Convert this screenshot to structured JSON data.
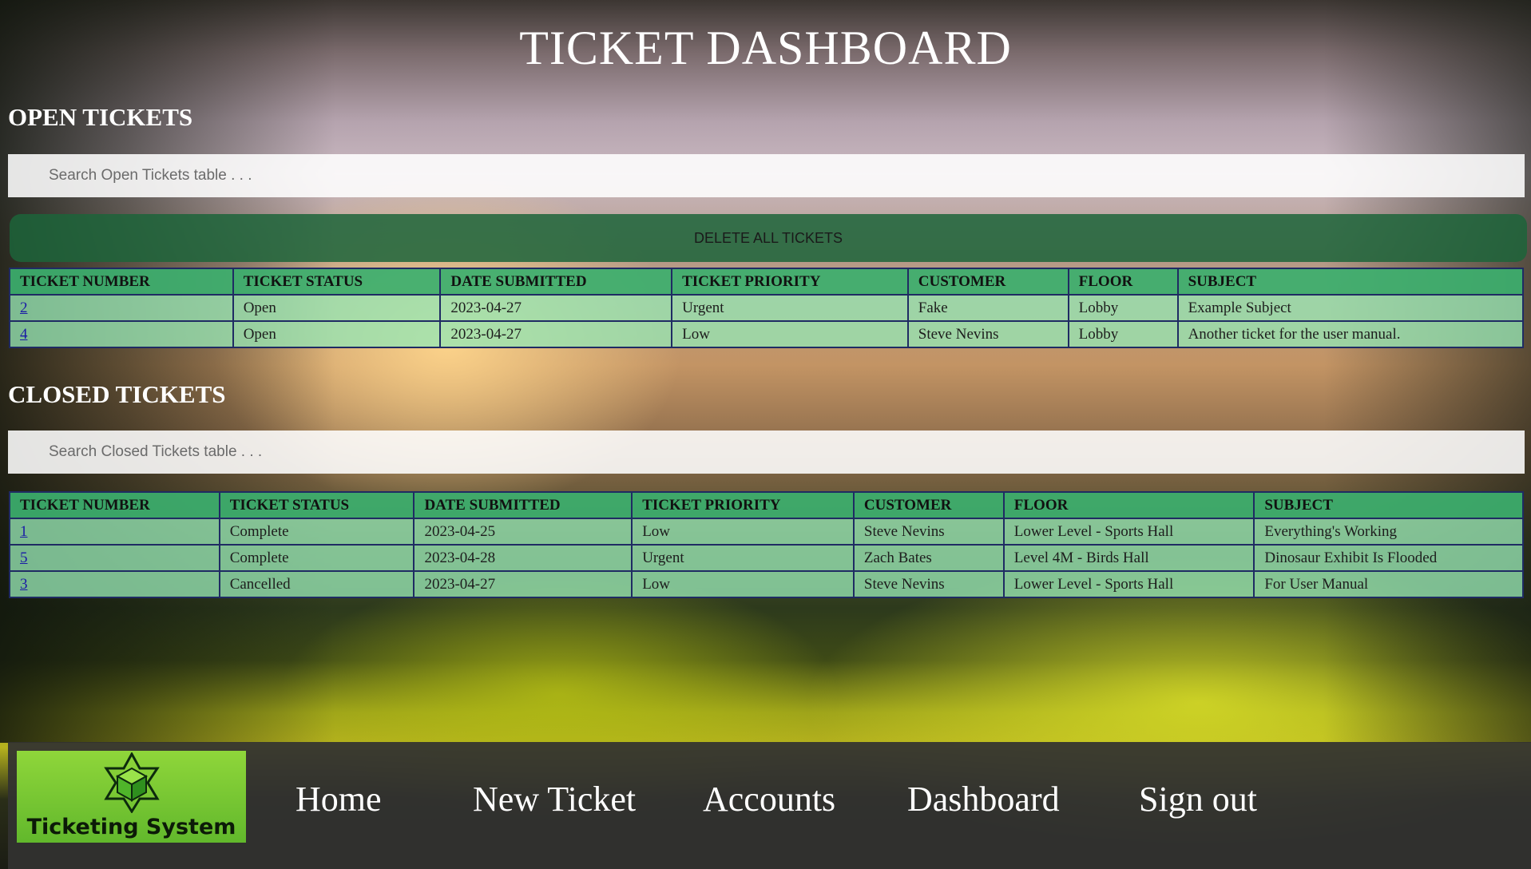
{
  "page": {
    "title": "TICKET DASHBOARD"
  },
  "open_tickets": {
    "heading": "OPEN TICKETS",
    "search_placeholder": "Search Open Tickets table . . .",
    "delete_all_label": "DELETE ALL TICKETS",
    "columns": [
      "TICKET NUMBER",
      "TICKET STATUS",
      "DATE SUBMITTED",
      "TICKET PRIORITY",
      "CUSTOMER",
      "FLOOR",
      "SUBJECT"
    ],
    "rows": [
      [
        "2",
        "Open",
        "2023-04-27",
        "Urgent",
        "Fake",
        "Lobby",
        "Example Subject"
      ],
      [
        "4",
        "Open",
        "2023-04-27",
        "Low",
        "Steve Nevins",
        "Lobby",
        "Another ticket for the user manual."
      ]
    ]
  },
  "closed_tickets": {
    "heading": "CLOSED TICKETS",
    "search_placeholder": "Search Closed Tickets table . . .",
    "columns": [
      "TICKET NUMBER",
      "TICKET STATUS",
      "DATE SUBMITTED",
      "TICKET PRIORITY",
      "CUSTOMER",
      "FLOOR",
      "SUBJECT"
    ],
    "rows": [
      [
        "1",
        "Complete",
        "2023-04-25",
        "Low",
        "Steve Nevins",
        "Lower Level - Sports Hall",
        "Everything's Working"
      ],
      [
        "5",
        "Complete",
        "2023-04-28",
        "Urgent",
        "Zach Bates",
        "Level 4M - Birds Hall",
        "Dinosaur Exhibit Is Flooded"
      ],
      [
        "3",
        "Cancelled",
        "2023-04-27",
        "Low",
        "Steve Nevins",
        "Lower Level - Sports Hall",
        "For User Manual"
      ]
    ]
  },
  "navbar": {
    "logo_text": "Ticketing System",
    "logo_icon": "cube-star-icon",
    "links": [
      "Home",
      "New Ticket",
      "Accounts",
      "Dashboard",
      "Sign out"
    ]
  },
  "colors": {
    "header_row": "#3caf6e",
    "body_row": "#96e6b4",
    "delete_button": "#1c643a",
    "navbar": "#323230",
    "logo_bg": "#62b82c"
  }
}
